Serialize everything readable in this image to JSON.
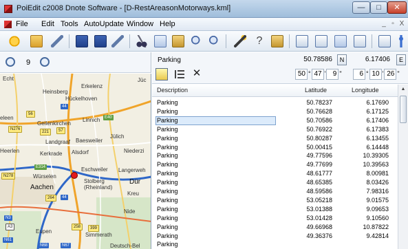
{
  "window": {
    "title": "PoiEdit c2008 Dnote Software - [D-RestAreasonMotorways.kml]",
    "minimize": "—",
    "maximize": "□",
    "close": "✕"
  },
  "menu": {
    "items": [
      "File",
      "Edit",
      "Tools",
      "AutoUpdate",
      "Window",
      "Help"
    ],
    "mdi_min": "_",
    "mdi_max": "▫",
    "mdi_close": "X"
  },
  "map_toolbar": {
    "zoom_level": "9"
  },
  "map": {
    "labels": [
      "Echt",
      "Erkelenz",
      "Heinsberg",
      "Hückelhoven",
      "eleen",
      "Geilenkirchen",
      "Linnich",
      "Landgraaf",
      "Baesweiler",
      "Jülich",
      "Heerlen",
      "Kerkrade",
      "Alsdorf",
      "Niederzi",
      "Würselen",
      "Eschweiler",
      "Langerweh",
      "Aachen",
      "Stolberg (Rheinland)",
      "Dür",
      "Kreu",
      "Eupen",
      "Nide",
      "Simmerath",
      "Deutsch-Bel"
    ],
    "badges": [
      "56",
      "N276",
      "221",
      "57",
      "44",
      "E314",
      "N278",
      "264",
      "44",
      "N3",
      "A3",
      "258",
      "399",
      "N61",
      "N68",
      "N67",
      "E40",
      "Jüc"
    ]
  },
  "location": {
    "name": "Parking",
    "latitude": "50.78586",
    "ns": "N",
    "longitude": "6.17406",
    "ew": "E",
    "lat_dms": {
      "deg": "50",
      "min": "47",
      "sec": "9"
    },
    "lon_dms": {
      "deg": "6",
      "min": "10",
      "sec": "26"
    },
    "deg_mark": "°",
    "min_mark": "'",
    "sec_mark": "\""
  },
  "table": {
    "columns": [
      "Description",
      "Latitude",
      "Longitude"
    ],
    "selected_index": 2,
    "rows": [
      [
        "Parking",
        "50.78237",
        "6.17690"
      ],
      [
        "Parking",
        "50.76628",
        "6.17125"
      ],
      [
        "Parking",
        "50.70586",
        "6.17406"
      ],
      [
        "Parking",
        "50.76922",
        "6.17383"
      ],
      [
        "Parking",
        "50.80287",
        "6.13455"
      ],
      [
        "Parking",
        "50.00415",
        "6.14448"
      ],
      [
        "Parking",
        "49.77596",
        "10.39305"
      ],
      [
        "Parking",
        "49.77699",
        "10.39563"
      ],
      [
        "Parking",
        "48.61777",
        "8.00981"
      ],
      [
        "Parking",
        "48.65385",
        "8.03426"
      ],
      [
        "Parking",
        "48.59586",
        "7.98316"
      ],
      [
        "Parking",
        "53.05218",
        "9.01575"
      ],
      [
        "Parking",
        "53.01388",
        "9.09653"
      ],
      [
        "Parking",
        "53.01428",
        "9.10560"
      ],
      [
        "Parking",
        "49.66968",
        "10.87822"
      ],
      [
        "Parking",
        "49.36376",
        "9.42814"
      ],
      [
        "Parking",
        "",
        ""
      ]
    ]
  }
}
